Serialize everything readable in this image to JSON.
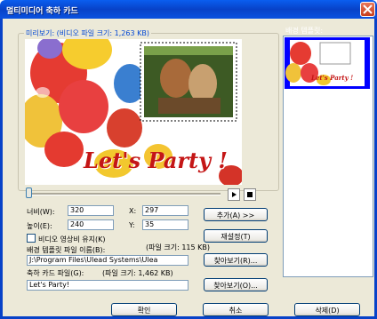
{
  "window": {
    "title": "멀티미디어 축하 카드"
  },
  "preview": {
    "group_label": "미리보기: (비디오 파일 크기: 1,263 KB)",
    "card_text": "Let's Party !",
    "colors": {
      "card_text": "#c41616",
      "frame_bg": "#ffffff",
      "balloon_red": "#e53b32",
      "balloon_yellow": "#f4c431"
    }
  },
  "templates": {
    "label": "배경 템플릿:",
    "thumb_text": "Let's Party !"
  },
  "playback": {
    "position": 0,
    "play_icon": "play-icon",
    "stop_icon": "stop-icon"
  },
  "size_fields": {
    "width_label": "너비(W):",
    "width_value": "320",
    "x_label": "X:",
    "x_value": "297",
    "height_label": "높이(E):",
    "height_value": "240",
    "y_label": "Y:",
    "y_value": "35"
  },
  "buttons": {
    "add": "추가(A) >>",
    "reset": "재설정(T)",
    "browse1": "찾아보기(R)...",
    "browse2": "찾아보기(O)...",
    "ok": "확인",
    "cancel": "취소",
    "delete": "삭제(D)"
  },
  "options": {
    "keep_ratio_label": "비디오 영상비 유지(K)",
    "keep_ratio_checked": false
  },
  "template_file": {
    "label": "배경 템플릿 파일 이름(B):",
    "size_note": "(파일 크기: 115 KB)",
    "path": "J:\\Program Files\\Ulead Systems\\Ulea"
  },
  "card_file": {
    "label": "축하 카드 파일(G):",
    "size_note": "(파일 크기: 1,462 KB)",
    "value": "Let's Party!"
  }
}
